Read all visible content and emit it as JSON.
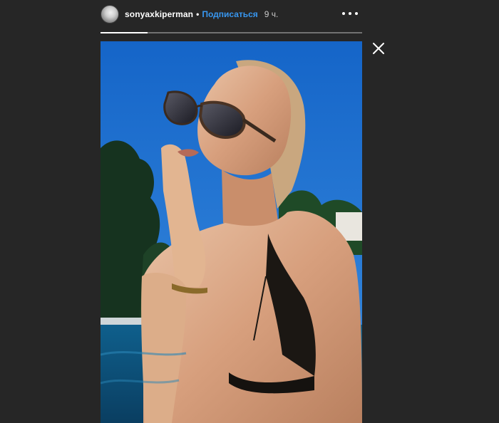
{
  "header": {
    "username": "sonyaxkiperman",
    "separator": "•",
    "follow_label": "Подписаться",
    "time_ago": "9 ч."
  },
  "progress": {
    "fraction": 0.18
  },
  "icons": {
    "avatar": "avatar-image",
    "more": "more-options-icon",
    "close": "close-icon"
  },
  "colors": {
    "background": "#262626",
    "follow": "#3897f0",
    "sky": "#1d6cc7"
  }
}
